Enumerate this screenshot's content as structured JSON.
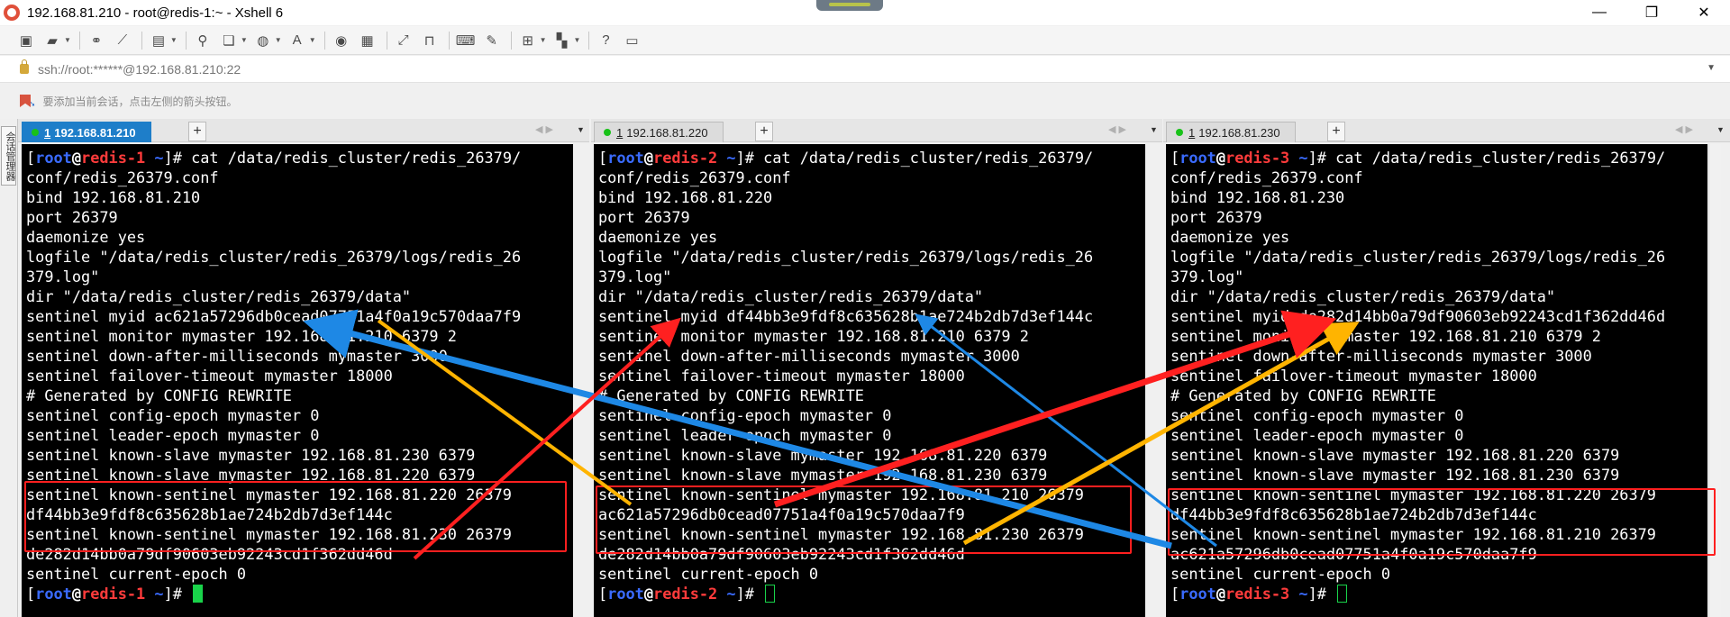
{
  "window": {
    "title": "192.168.81.210 - root@redis-1:~ - Xshell 6",
    "minimize": "—",
    "maximize": "❐",
    "close": "✕"
  },
  "toolbar": {
    "icons": [
      "new-session-icon",
      "open-folder-icon",
      "link-icon",
      "disconnect-icon",
      "properties-icon",
      "find-icon",
      "copy-icon",
      "globe-icon",
      "font-icon",
      "xftp-icon",
      "key-icon",
      "fullscreen-icon",
      "lock-icon",
      "keyboard-icon",
      "compose-icon",
      "add-icon",
      "layout-icon",
      "help-icon",
      "chat-icon"
    ]
  },
  "address": {
    "value": "ssh://root:******@192.168.81.210:22"
  },
  "hint": {
    "text": "要添加当前会话，点击左侧的箭头按钮。"
  },
  "side_panel": {
    "label": "会话管理器"
  },
  "colors": {
    "tab_active": "#1e7ec9",
    "highlight_box": "#ff1f1f",
    "arrow_red": "#ff2020",
    "arrow_blue": "#1e88e5",
    "arrow_orange": "#ffb400"
  },
  "sessions": [
    {
      "tab_number": "1",
      "tab_label": "192.168.81.210",
      "prompt": {
        "user": "root",
        "host": "redis-1",
        "path": "~"
      },
      "command": "cat /data/redis_cluster/redis_26379/",
      "lines": [
        "conf/redis_26379.conf",
        "bind 192.168.81.210",
        "port 26379",
        "daemonize yes",
        "logfile \"/data/redis_cluster/redis_26379/logs/redis_26",
        "379.log\"",
        "dir \"/data/redis_cluster/redis_26379/data\"",
        "sentinel myid ac621a57296db0cead07751a4f0a19c570daa7f9",
        "sentinel monitor mymaster 192.168.81.210 6379 2",
        "sentinel down-after-milliseconds mymaster 3000",
        "sentinel failover-timeout mymaster 18000",
        "# Generated by CONFIG REWRITE",
        "sentinel config-epoch mymaster 0",
        "sentinel leader-epoch mymaster 0",
        "sentinel known-slave mymaster 192.168.81.230 6379",
        "sentinel known-slave mymaster 192.168.81.220 6379",
        "sentinel known-sentinel mymaster 192.168.81.220 26379",
        "df44bb3e9fdf8c635628b1ae724b2db7d3ef144c",
        "sentinel known-sentinel mymaster 192.168.81.230 26379",
        "de282d14bb0a79df90603eb92243cd1f362dd46d",
        "sentinel current-epoch 0"
      ]
    },
    {
      "tab_number": "1",
      "tab_label": "192.168.81.220",
      "prompt": {
        "user": "root",
        "host": "redis-2",
        "path": "~"
      },
      "command": "cat /data/redis_cluster/redis_26379/",
      "lines": [
        "conf/redis_26379.conf",
        "bind 192.168.81.220",
        "port 26379",
        "daemonize yes",
        "logfile \"/data/redis_cluster/redis_26379/logs/redis_26",
        "379.log\"",
        "dir \"/data/redis_cluster/redis_26379/data\"",
        "sentinel myid df44bb3e9fdf8c635628b1ae724b2db7d3ef144c",
        "sentinel monitor mymaster 192.168.81.210 6379 2",
        "sentinel down-after-milliseconds mymaster 3000",
        "sentinel failover-timeout mymaster 18000",
        "# Generated by CONFIG REWRITE",
        "sentinel config-epoch mymaster 0",
        "sentinel leader-epoch mymaster 0",
        "sentinel known-slave mymaster 192.168.81.220 6379",
        "sentinel known-slave mymaster 192.168.81.230 6379",
        "sentinel known-sentinel mymaster 192.168.81.210 26379",
        "ac621a57296db0cead07751a4f0a19c570daa7f9",
        "sentinel known-sentinel mymaster 192.168.81.230 26379",
        "de282d14bb0a79df90603eb92243cd1f362dd46d",
        "sentinel current-epoch 0"
      ]
    },
    {
      "tab_number": "1",
      "tab_label": "192.168.81.230",
      "prompt": {
        "user": "root",
        "host": "redis-3",
        "path": "~"
      },
      "command": "cat /data/redis_cluster/redis_26379/",
      "lines": [
        "conf/redis_26379.conf",
        "bind 192.168.81.230",
        "port 26379",
        "daemonize yes",
        "logfile \"/data/redis_cluster/redis_26379/logs/redis_26",
        "379.log\"",
        "dir \"/data/redis_cluster/redis_26379/data\"",
        "sentinel myid de282d14bb0a79df90603eb92243cd1f362dd46d",
        "sentinel monitor mymaster 192.168.81.210 6379 2",
        "sentinel down-after-milliseconds mymaster 3000",
        "sentinel failover-timeout mymaster 18000",
        "# Generated by CONFIG REWRITE",
        "sentinel config-epoch mymaster 0",
        "sentinel leader-epoch mymaster 0",
        "sentinel known-slave mymaster 192.168.81.220 6379",
        "sentinel known-slave mymaster 192.168.81.230 6379",
        "sentinel known-sentinel mymaster 192.168.81.220 26379",
        "df44bb3e9fdf8c635628b1ae724b2db7d3ef144c",
        "sentinel known-sentinel mymaster 192.168.81.210 26379",
        "ac621a57296db0cead07751a4f0a19c570daa7f9",
        "sentinel current-epoch 0"
      ]
    }
  ]
}
